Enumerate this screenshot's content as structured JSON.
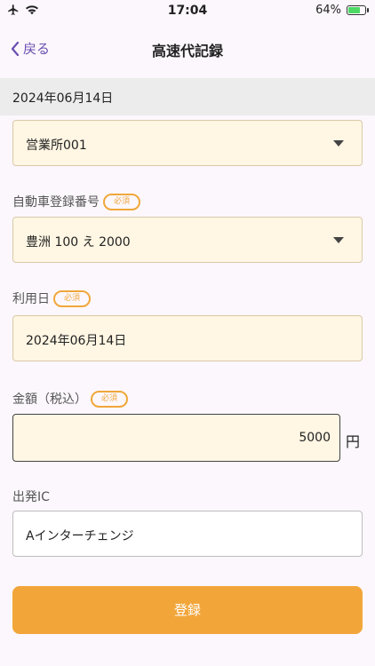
{
  "status_bar": {
    "time": "17:04",
    "battery_percent": "64%",
    "battery_level": 0.64,
    "icons": [
      "airplane-icon",
      "wifi-icon",
      "battery-charging-icon"
    ]
  },
  "nav": {
    "back_label": "戻る",
    "title": "高速代記録"
  },
  "date_bar": {
    "date": "2024年06月14日"
  },
  "form": {
    "office": {
      "value": "営業所001"
    },
    "car_number": {
      "label": "自動車登録番号",
      "required": "必須",
      "value": "豊洲 100 え 2000"
    },
    "use_date": {
      "label": "利用日",
      "required": "必須",
      "value": "2024年06月14日"
    },
    "amount": {
      "label": "金額（税込）",
      "required": "必須",
      "value": "5000",
      "unit": "円"
    },
    "departure_ic": {
      "label": "出発IC",
      "value": "Aインターチェンジ"
    }
  },
  "submit_label": "登録",
  "colors": {
    "accent": "#f2a63a",
    "back_link": "#6a4fb0",
    "field_bg": "#fff6e3"
  }
}
